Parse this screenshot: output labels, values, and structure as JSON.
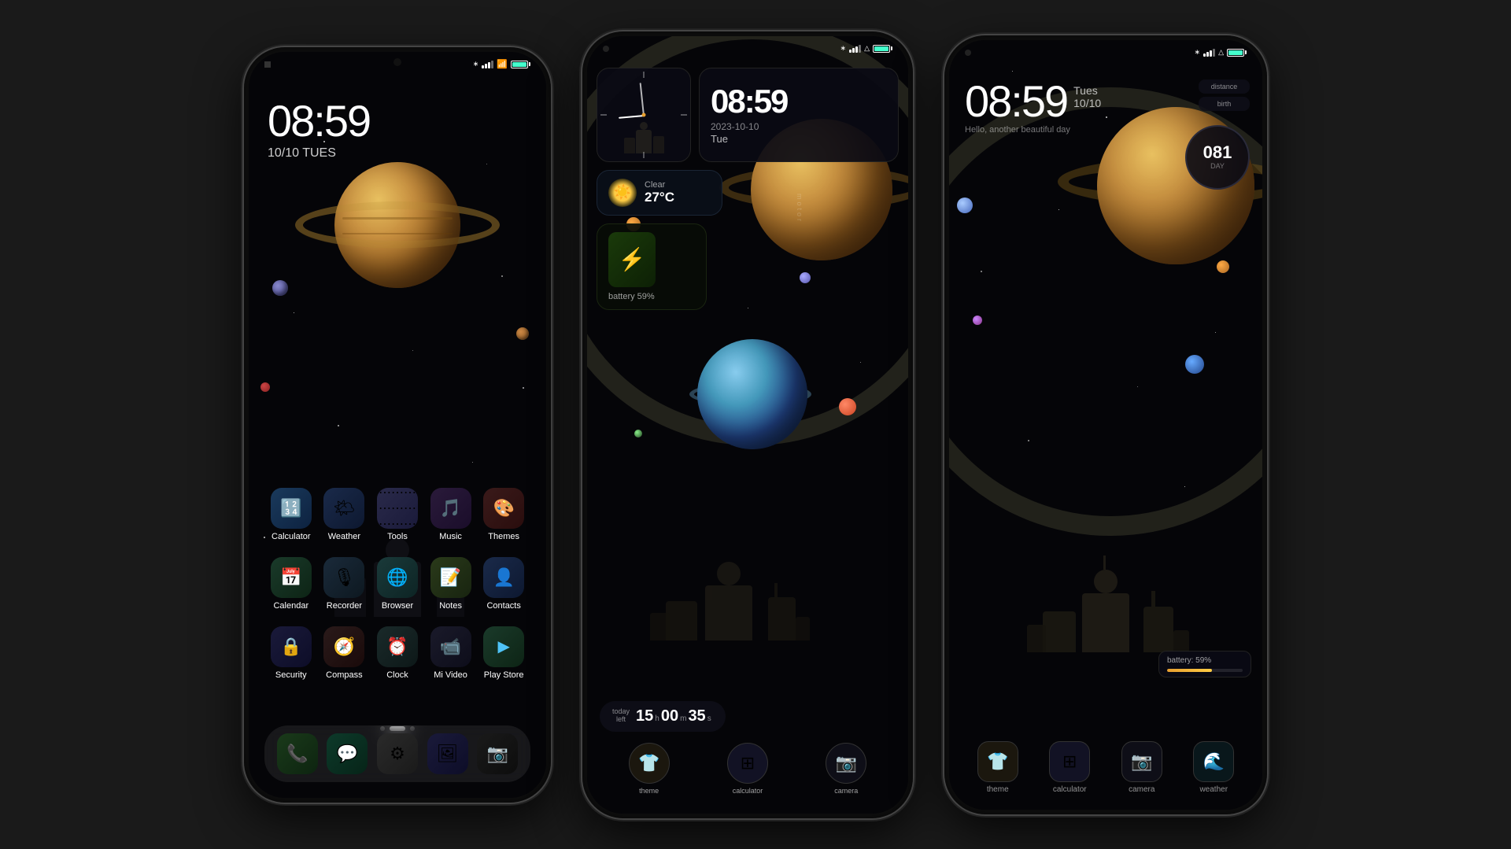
{
  "phones": [
    {
      "id": "phone-1",
      "clock": {
        "time": "08:59",
        "date": "10/10 TUES"
      },
      "status": {
        "battery_level": "100",
        "signal": "4",
        "wifi": "on",
        "bluetooth": "on"
      },
      "app_rows": [
        [
          {
            "name": "Calculator",
            "icon": "🔢",
            "color_class": "icon-calc"
          },
          {
            "name": "Weather",
            "icon": "🌤",
            "color_class": "icon-weather"
          },
          {
            "name": "Tools",
            "icon": "⚙️",
            "color_class": "icon-tools"
          },
          {
            "name": "Music",
            "icon": "🎵",
            "color_class": "icon-music"
          },
          {
            "name": "Themes",
            "icon": "🎨",
            "color_class": "icon-themes"
          }
        ],
        [
          {
            "name": "Calendar",
            "icon": "📅",
            "color_class": "icon-calendar"
          },
          {
            "name": "Recorder",
            "icon": "🎙",
            "color_class": "icon-recorder"
          },
          {
            "name": "Browser",
            "icon": "🌐",
            "color_class": "icon-browser"
          },
          {
            "name": "Notes",
            "icon": "📝",
            "color_class": "icon-notes"
          },
          {
            "name": "Contacts",
            "icon": "👤",
            "color_class": "icon-contacts"
          }
        ],
        [
          {
            "name": "Security",
            "icon": "🔒",
            "color_class": "icon-security"
          },
          {
            "name": "Compass",
            "icon": "🧭",
            "color_class": "icon-compass"
          },
          {
            "name": "Clock",
            "icon": "⏰",
            "color_class": "icon-clock"
          },
          {
            "name": "Mi Video",
            "icon": "▶️",
            "color_class": "icon-video"
          },
          {
            "name": "Play Store",
            "icon": "▶",
            "color_class": "icon-playstore"
          }
        ]
      ],
      "dock_icons": [
        {
          "name": "Phone",
          "icon": "📞",
          "color_class": "icon-phone"
        },
        {
          "name": "Messages",
          "icon": "💬",
          "color_class": "icon-messages"
        },
        {
          "name": "Settings",
          "icon": "⚙",
          "color_class": "icon-settings"
        },
        {
          "name": "Gallery",
          "icon": "🖼",
          "color_class": "icon-gallery"
        },
        {
          "name": "Camera",
          "icon": "📷",
          "color_class": "icon-camera"
        }
      ],
      "page_dots": [
        false,
        true,
        false
      ]
    },
    {
      "id": "phone-2",
      "analog_clock": {
        "hour_angle": "265",
        "minute_angle": "354"
      },
      "digital_clock": {
        "time": "08:59",
        "date": "2023-10-10",
        "day": "Tue"
      },
      "weather": {
        "condition": "Clear",
        "temperature": "27°C",
        "icon": "☀️"
      },
      "battery": {
        "percent": "59%",
        "label": "battery 59%"
      },
      "timer": {
        "label_1": "today",
        "label_2": "left",
        "hours": "15",
        "minutes": "00",
        "seconds": "35"
      },
      "shortcuts": [
        {
          "name": "theme",
          "icon": "👕",
          "color_class": "icon-theme"
        },
        {
          "name": "calculator",
          "icon": "⊞",
          "color_class": "icon-calc-grid"
        },
        {
          "name": "camera",
          "icon": "📷",
          "color_class": "icon-camera-dark"
        }
      ]
    },
    {
      "id": "phone-3",
      "clock": {
        "time": "08:59",
        "day_abbr": "Tues",
        "date": "10/10",
        "greeting": "Hello, another beautiful day"
      },
      "info_cards": [
        {
          "label": "distance",
          "value": ""
        },
        {
          "label": "birth",
          "value": ""
        }
      ],
      "day_counter": {
        "number": "081",
        "label": "DAY"
      },
      "battery": {
        "text": "battery: 59%",
        "percent": 59
      },
      "dock_items": [
        {
          "name": "theme",
          "icon": "👕",
          "color_class": "icon-theme"
        },
        {
          "name": "calculator",
          "icon": "⊞",
          "color_class": "icon-calc-grid"
        },
        {
          "name": "camera",
          "icon": "📷",
          "color_class": "icon-camera-dark"
        },
        {
          "name": "weather",
          "icon": "🌊",
          "color_class": "icon-weather-teal"
        }
      ]
    }
  ]
}
